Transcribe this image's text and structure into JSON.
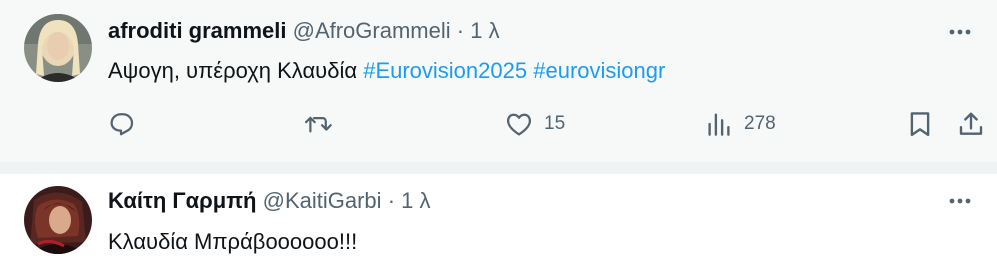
{
  "tweets": [
    {
      "name": "afroditi grammeli",
      "handle": "@AfroGrammeli",
      "separator": "·",
      "time": "1 λ",
      "text": "Αψογη, υπέροχη Κλαυδία",
      "hashtags": [
        "#Eurovision2025",
        "#eurovisiongr"
      ],
      "actions": {
        "reply_icon": "reply-icon",
        "retweet_icon": "retweet-icon",
        "like_icon": "heart-icon",
        "like_count": "15",
        "views_icon": "views-icon",
        "views_count": "278",
        "bookmark_icon": "bookmark-icon",
        "share_icon": "share-icon"
      },
      "more_icon": "more-icon"
    },
    {
      "name": "Καίτη Γαρμπή",
      "handle": "@KaitiGarbi",
      "separator": "·",
      "time": "1 λ",
      "text": "Κλαυδία Μπράβοοοοοο!!!",
      "more_icon": "more-icon"
    }
  ],
  "colors": {
    "link": "#1d9bf0",
    "secondary": "#536471",
    "primary_text": "#0f1419",
    "hover_bg": "#f7f9f9",
    "divider": "#eff3f4"
  }
}
